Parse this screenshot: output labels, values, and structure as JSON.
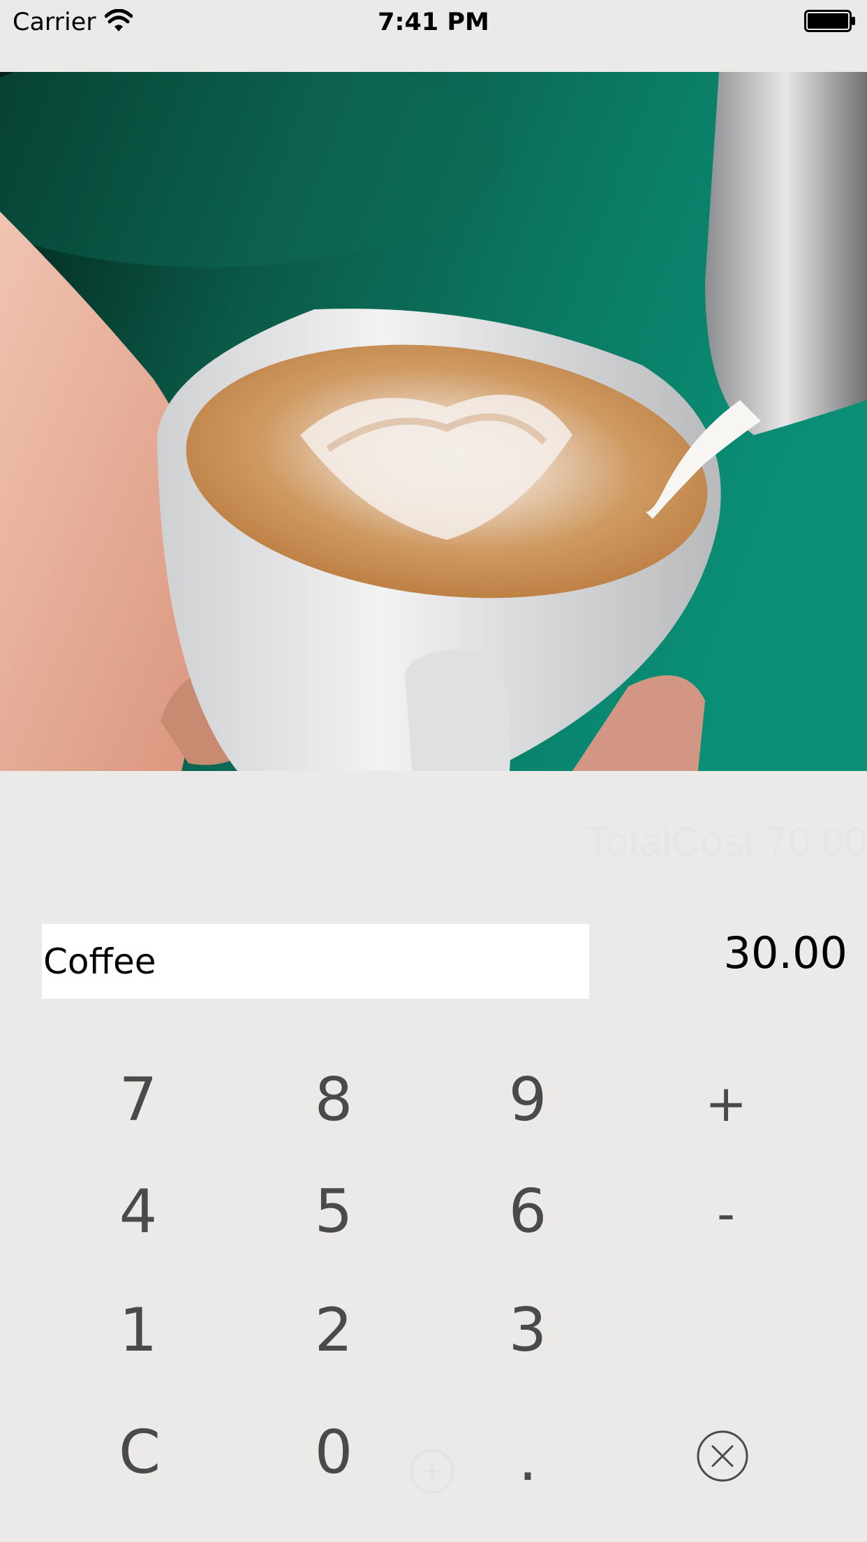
{
  "status_bar": {
    "carrier": "Carrier",
    "time": "7:41 PM",
    "icons": [
      "wifi-icon",
      "battery-icon"
    ]
  },
  "hero": {
    "image": "latte-art-coffee-photo"
  },
  "summary": {
    "total_cost": "TotalCost:70.00"
  },
  "entry": {
    "item_name": "Coffee",
    "amount": "30.00"
  },
  "keypad": {
    "k7": "7",
    "k8": "8",
    "k9": "9",
    "plus": "+",
    "k4": "4",
    "k5": "5",
    "k6": "6",
    "minus": "-",
    "k1": "1",
    "k2": "2",
    "k3": "3",
    "clear": "C",
    "k0": "0",
    "dot": ".",
    "delete_icon": "circle-x-icon"
  },
  "colors": {
    "background": "#ebeae8",
    "key_text": "#4a4a4a",
    "field_bg": "#ffffff"
  }
}
